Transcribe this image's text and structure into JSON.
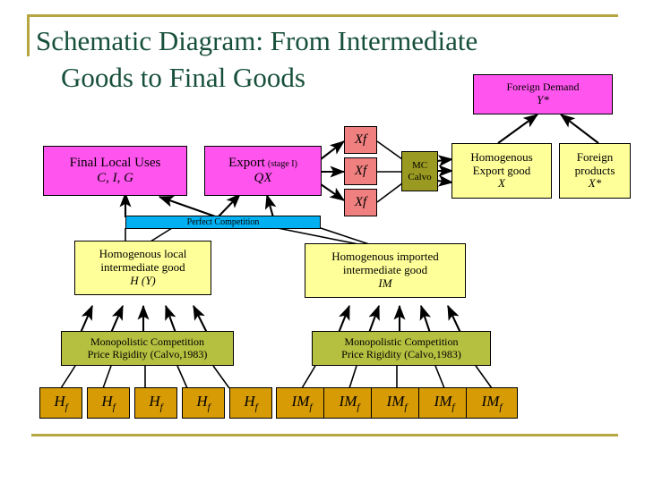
{
  "slide": {
    "title_line1": "Schematic Diagram: From Intermediate",
    "title_line2": "Goods to Final Goods",
    "title_color": "#17503a",
    "rule_color": "#b5a642",
    "background": "#ffffff"
  },
  "colors": {
    "magenta": "#ff55ee",
    "salmon": "#f08080",
    "olive": "#9a9a22",
    "yellow": "#ffff99",
    "cyan": "#00b0f0",
    "green": "#b5bf40",
    "gold": "#d69b05",
    "border": "#000000"
  },
  "nodes": {
    "foreign_demand": {
      "line1": "Foreign Demand",
      "line2": "Y*"
    },
    "final_local_uses": {
      "line1": "Final Local Uses",
      "line2": "C, I, G"
    },
    "export_stage1": {
      "line1": "Export",
      "line1_sub": "(stage I)",
      "line2": "QX"
    },
    "xf_boxes": [
      {
        "label": "Xf"
      },
      {
        "label": "Xf"
      },
      {
        "label": "Xf"
      }
    ],
    "mc_calvo": {
      "line1": "MC",
      "line2": "Calvo"
    },
    "homogenous_export_good": {
      "line1": "Homogenous",
      "line2": "Export good",
      "line3": "X"
    },
    "foreign_products": {
      "line1": "Foreign",
      "line2": "products",
      "line3": "X*"
    },
    "perfect_competition": {
      "label": "Perfect Competition"
    },
    "homogenous_local": {
      "line1": "Homogenous local",
      "line2": "intermediate good",
      "line3": "H (Y)"
    },
    "homogenous_imported": {
      "line1": "Homogenous imported",
      "line2": "intermediate good",
      "line3": "IM"
    },
    "monopolistic_left": {
      "line1": "Monopolistic Competition",
      "line2": "Price Rigidity (Calvo,1983)"
    },
    "monopolistic_right": {
      "line1": "Monopolistic Competition",
      "line2": "Price Rigidity (Calvo,1983)"
    },
    "hf_boxes": [
      {
        "base": "H",
        "sub": "f"
      },
      {
        "base": "H",
        "sub": "f"
      },
      {
        "base": "H",
        "sub": "f"
      },
      {
        "base": "H",
        "sub": "f"
      },
      {
        "base": "H",
        "sub": "f"
      }
    ],
    "imf_boxes": [
      {
        "base": "IM",
        "sub": "f"
      },
      {
        "base": "IM",
        "sub": "f"
      },
      {
        "base": "IM",
        "sub": "f"
      },
      {
        "base": "IM",
        "sub": "f"
      },
      {
        "base": "IM",
        "sub": "f"
      }
    ]
  }
}
